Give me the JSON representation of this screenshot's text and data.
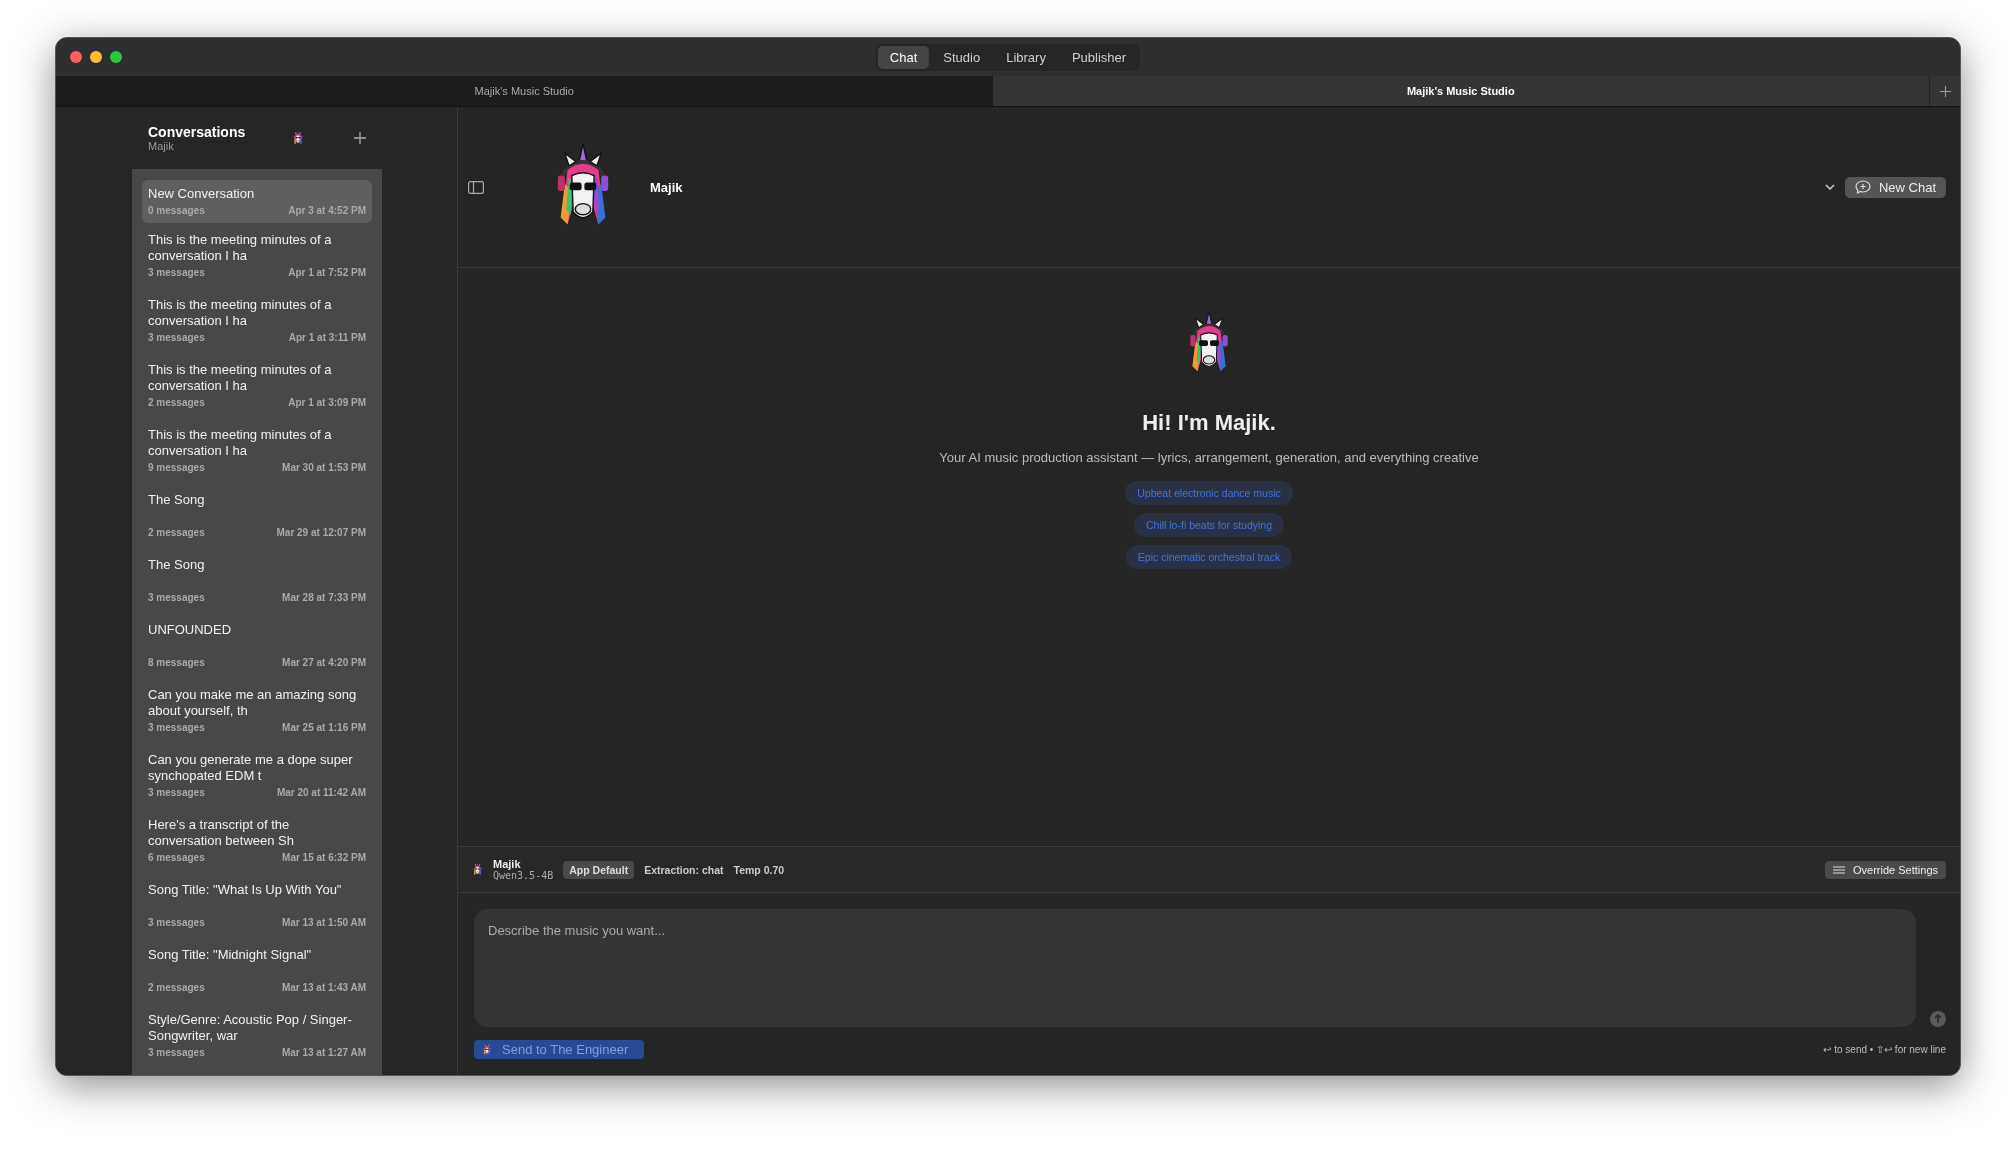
{
  "window": {
    "tabs": [
      {
        "label": "Chat",
        "selected": true
      },
      {
        "label": "Studio",
        "selected": false
      },
      {
        "label": "Library",
        "selected": false
      },
      {
        "label": "Publisher",
        "selected": false
      }
    ]
  },
  "doc_tabs": [
    {
      "label": "Majik's Music Studio",
      "selected": false
    },
    {
      "label": "Majik's Music Studio",
      "selected": true
    }
  ],
  "sidebar": {
    "title": "Conversations",
    "subtitle": "Majik",
    "items": [
      {
        "title": "New Conversation",
        "count": "0 messages",
        "date": "Apr 3 at 4:52 PM",
        "selected": true
      },
      {
        "title": "This is the meeting minutes of a conversation I ha",
        "count": "3 messages",
        "date": "Apr 1 at 7:52 PM",
        "selected": false
      },
      {
        "title": "This is the meeting minutes of a conversation I ha",
        "count": "3 messages",
        "date": "Apr 1 at 3:11 PM",
        "selected": false
      },
      {
        "title": "This is the meeting minutes of a conversation I ha",
        "count": "2 messages",
        "date": "Apr 1 at 3:09 PM",
        "selected": false
      },
      {
        "title": "This is the meeting minutes of a conversation I ha",
        "count": "9 messages",
        "date": "Mar 30 at 1:53 PM",
        "selected": false
      },
      {
        "title": "The Song",
        "count": "2 messages",
        "date": "Mar 29 at 12:07 PM",
        "selected": false
      },
      {
        "title": "The Song",
        "count": "3 messages",
        "date": "Mar 28 at 7:33 PM",
        "selected": false
      },
      {
        "title": "UNFOUNDED",
        "count": "8 messages",
        "date": "Mar 27 at 4:20 PM",
        "selected": false
      },
      {
        "title": "Can you make me an amazing song about yourself, th",
        "count": "3 messages",
        "date": "Mar 25 at 1:16 PM",
        "selected": false
      },
      {
        "title": "Can you generate me a dope super synchopated EDM t",
        "count": "3 messages",
        "date": "Mar 20 at 11:42 AM",
        "selected": false
      },
      {
        "title": "Here's a transcript of the conversation between Sh",
        "count": "6 messages",
        "date": "Mar 15 at 6:32 PM",
        "selected": false
      },
      {
        "title": "Song Title: \"What Is Up With You\"",
        "count": "3 messages",
        "date": "Mar 13 at 1:50 AM",
        "selected": false
      },
      {
        "title": "Song Title: \"Midnight Signal\"",
        "count": "2 messages",
        "date": "Mar 13 at 1:43 AM",
        "selected": false
      },
      {
        "title": "Style/Genre: Acoustic Pop / Singer-Songwriter, war",
        "count": "3 messages",
        "date": "Mar 13 at 1:27 AM",
        "selected": false
      }
    ]
  },
  "header": {
    "name": "Majik",
    "new_chat": "New Chat"
  },
  "welcome": {
    "heading": "Hi! I'm Majik.",
    "subtitle": "Your AI music production assistant — lyrics, arrangement, generation, and everything creative",
    "suggestions": [
      "Upbeat electronic dance music",
      "Chill lo-fi beats for studying",
      "Epic cinematic orchestral track"
    ]
  },
  "settings_bar": {
    "agent": "Majik",
    "model": "Qwen3.5-4B",
    "badge": "App Default",
    "extraction": "Extraction: chat",
    "temp": "Temp 0.70",
    "override": "Override Settings"
  },
  "composer": {
    "placeholder": "Describe the music you want...",
    "send_to": "Send to The Engineer",
    "hint": "↩ to send • ⇧↩ for new line"
  }
}
